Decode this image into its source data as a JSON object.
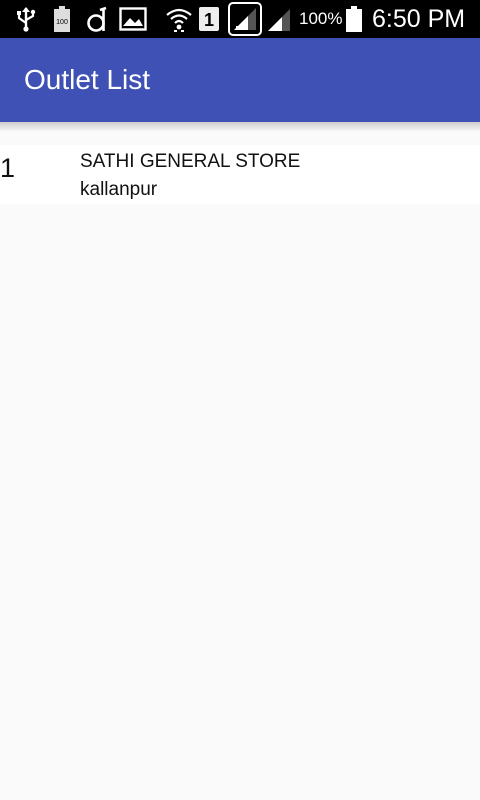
{
  "status_bar": {
    "icons": [
      "usb-icon",
      "battery-100-icon",
      "d-app-icon",
      "image-icon",
      "wifi-icon",
      "sim-1-icon",
      "signal-sim1-icon",
      "signal-sim2-icon",
      "battery-icon"
    ],
    "battery_badge": "100",
    "sim_label": "1",
    "battery_percent": "100%",
    "time": "6:50 PM"
  },
  "app_bar": {
    "title": "Outlet List",
    "color": "#3f51b5"
  },
  "outlets": [
    {
      "index": "1",
      "name": "SATHI GENERAL STORE",
      "area": "kallanpur"
    }
  ]
}
